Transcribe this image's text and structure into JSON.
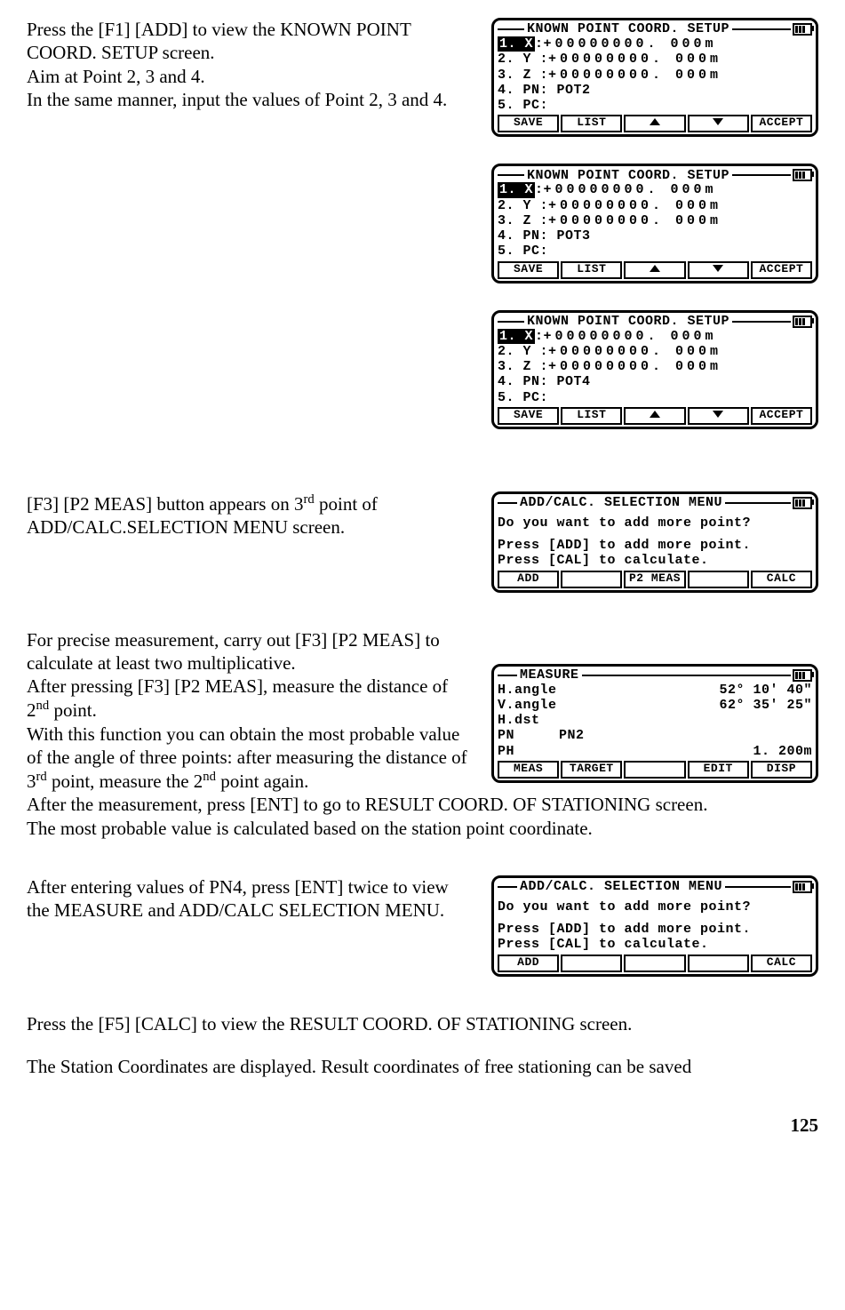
{
  "pageNumber": "125",
  "battery_icon": "battery-icon",
  "sections": {
    "s1": {
      "p1": "Press the [F1] [ADD] to view the KNOWN POINT COORD. SETUP screen.",
      "p2": "Aim at Point 2, 3 and 4.",
      "p3": "In the same manner, input the values of Point 2, 3 and 4."
    },
    "s2": {
      "p1a": "[F3] [P2 MEAS] button appears on 3",
      "p1sup": "rd",
      "p1b": " point of ADD/CALC.SELECTION MENU screen."
    },
    "s3": {
      "p1": "For precise measurement, carry out [F3] [P2 MEAS] to calculate at least two multiplicative.",
      "p2a": "After pressing [F3] [P2 MEAS], measure the distance of 2",
      "p2sup": "nd",
      "p2b": " point.",
      "p3a": "With this function you can obtain the most probable value of the angle of three points: after measuring the distance of 3",
      "p3sup1": "rd",
      "p3b": " point, measure the 2",
      "p3sup2": "nd",
      "p3c": " point again.",
      "p4": "After the measurement, press [ENT] to go to RESULT COORD. OF STATIONING screen.",
      "p5": "The most probable value is calculated based on the station point coordinate."
    },
    "s4": {
      "p1": "After entering values of PN4, press [ENT] twice to view the MEASURE and ADD/CALC SELECTION MENU."
    },
    "s5": {
      "p1": "Press the [F5] [CALC] to view the RESULT COORD. OF STATIONING screen.",
      "p2": "The Station Coordinates are displayed. Result coordinates of free stationing can be saved"
    }
  },
  "screens": {
    "knownPoint": {
      "title": "KNOWN POINT COORD. SETUP",
      "rows": {
        "x": {
          "label": "1. X",
          "value": "+00000000. 000m"
        },
        "y": {
          "label": "2. Y",
          "value": "+00000000. 000m"
        },
        "z": {
          "label": "3. Z",
          "value": "+00000000. 000m"
        },
        "pc": {
          "label": "5. PC",
          "value": ""
        }
      },
      "pnLabel": "4. PN",
      "pn": {
        "p2": "POT2",
        "p3": "POT3",
        "p4": "POT4"
      },
      "softkeys": {
        "k1": "SAVE",
        "k2": "LIST",
        "k3arrow": "up",
        "k4arrow": "down",
        "k5": "ACCEPT"
      }
    },
    "addCalc": {
      "title": "ADD/CALC. SELECTION MENU",
      "q": "Do you want to add more point?",
      "l1": "Press [ADD] to add more point.",
      "l2": "Press [CAL] to calculate.",
      "softkeysA": {
        "k1": "ADD",
        "k2": "",
        "k3": "P2 MEAS",
        "k4": "",
        "k5": "CALC"
      },
      "softkeysB": {
        "k1": "ADD",
        "k2": "",
        "k3": "",
        "k4": "",
        "k5": "CALC"
      }
    },
    "measure": {
      "title": "MEASURE",
      "rows": {
        "hangle": {
          "label": "H.angle",
          "value": "52° 10′ 40″"
        },
        "vangle": {
          "label": "V.angle",
          "value": "62° 35′ 25″"
        },
        "hdst": {
          "label": "H.dst",
          "value": ""
        },
        "pn": {
          "label": "PN",
          "value": "PN2"
        },
        "ph": {
          "label": "PH",
          "value": "1. 200m"
        }
      },
      "softkeys": {
        "k1": "MEAS",
        "k2": "TARGET",
        "k3": "",
        "k4": "EDIT",
        "k5": "DISP"
      }
    }
  }
}
